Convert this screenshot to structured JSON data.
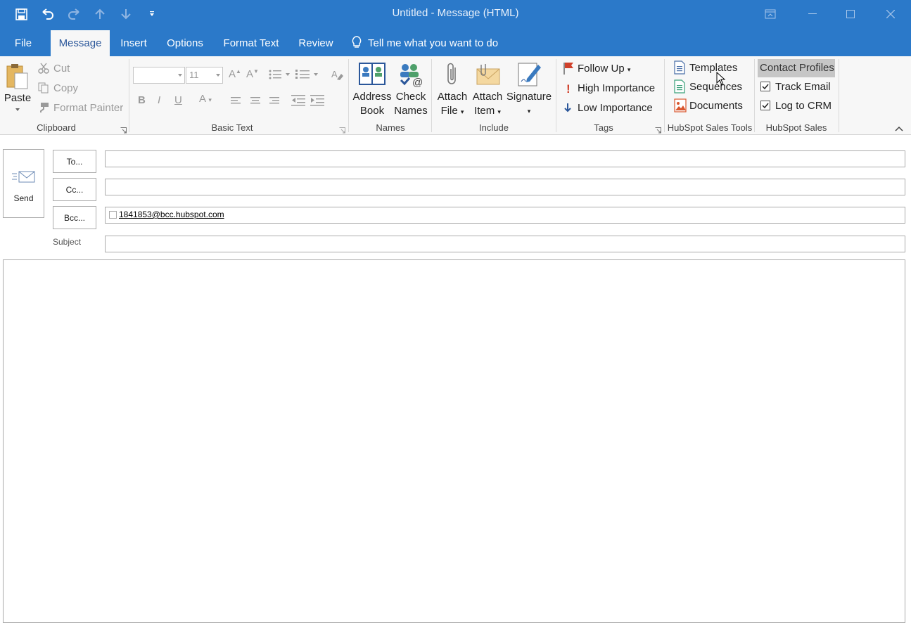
{
  "window": {
    "title": "Untitled - Message (HTML)"
  },
  "tabs": {
    "file": "File",
    "message": "Message",
    "insert": "Insert",
    "options": "Options",
    "format_text": "Format Text",
    "review": "Review",
    "tell_me": "Tell me what you want to do"
  },
  "ribbon": {
    "clipboard": {
      "label": "Clipboard",
      "paste": "Paste",
      "cut": "Cut",
      "copy": "Copy",
      "format_painter": "Format Painter"
    },
    "basic_text": {
      "label": "Basic Text",
      "font_size": "11",
      "bold": "B",
      "italic": "I",
      "underline": "U"
    },
    "names": {
      "label": "Names",
      "address_book_1": "Address",
      "address_book_2": "Book",
      "check_names_1": "Check",
      "check_names_2": "Names"
    },
    "include": {
      "label": "Include",
      "attach_file_1": "Attach",
      "attach_file_2": "File",
      "attach_item_1": "Attach",
      "attach_item_2": "Item",
      "signature": "Signature"
    },
    "tags": {
      "label": "Tags",
      "follow_up": "Follow Up",
      "high_importance": "High Importance",
      "low_importance": "Low Importance"
    },
    "hubspot_tools": {
      "label": "HubSpot Sales Tools",
      "templates": "Templates",
      "sequences": "Sequences",
      "documents": "Documents"
    },
    "hubspot_sales": {
      "label": "HubSpot Sales",
      "contact_profiles": "Contact Profiles",
      "track_email": "Track Email",
      "track_email_checked": true,
      "log_to_crm": "Log to CRM",
      "log_to_crm_checked": true
    }
  },
  "compose": {
    "send": "Send",
    "to_label": "To...",
    "cc_label": "Cc...",
    "bcc_label": "Bcc...",
    "subject_label": "Subject",
    "to_value": "",
    "cc_value": "",
    "bcc_value": "1841853@bcc.hubspot.com",
    "subject_value": "",
    "body": ""
  },
  "colors": {
    "titlebar": "#2b79c9",
    "ribbon_bg": "#f7f7f7",
    "active_tab_text": "#2b579a",
    "highlight": "#c6c6c6"
  }
}
